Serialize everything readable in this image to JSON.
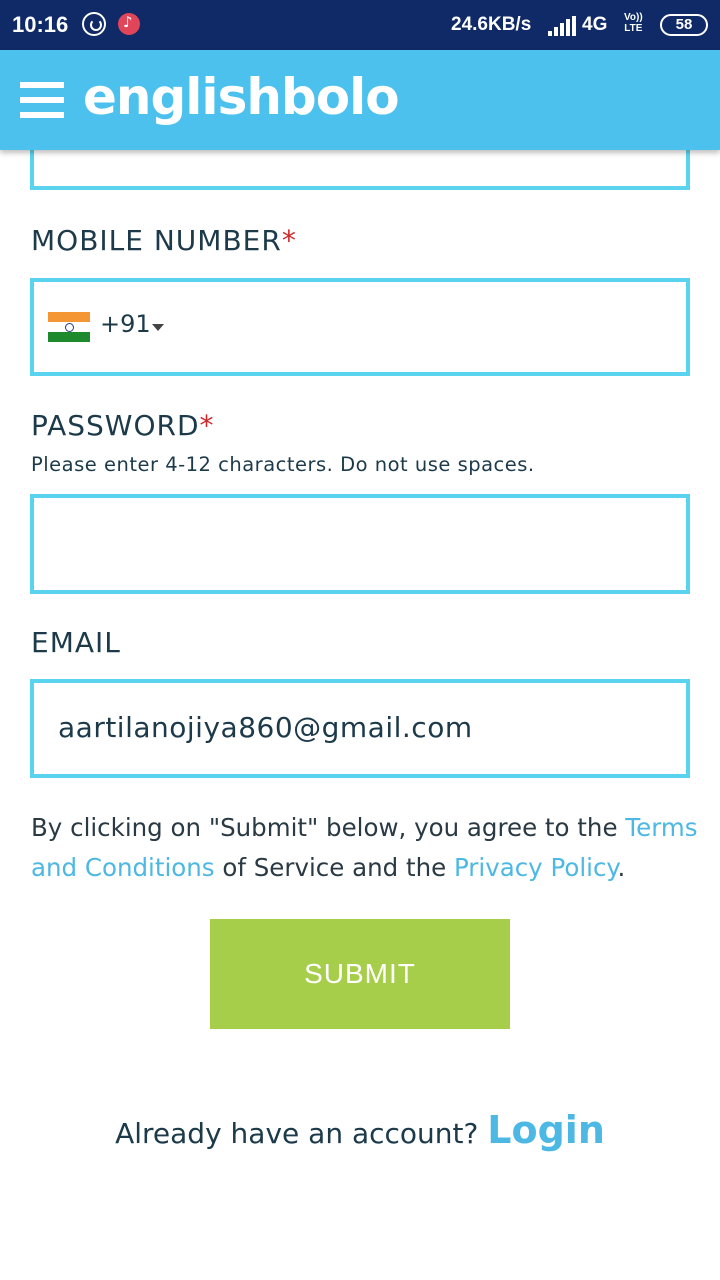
{
  "status_bar": {
    "time": "10:16",
    "net_speed": "24.6KB/s",
    "network": "4G",
    "volte_top": "Vo))",
    "volte_bottom": "LTE",
    "battery": "58",
    "icons": [
      "whatsapp-icon",
      "music-notification-icon",
      "signal-icon",
      "battery-icon"
    ]
  },
  "header": {
    "logo": "englishbolo",
    "menu_icon": "hamburger-menu-icon",
    "background": "#4cc1ee"
  },
  "form": {
    "mobile": {
      "label": "MOBILE NUMBER",
      "required_mark": "*",
      "country_code": "+91",
      "flag_icon": "india-flag-icon"
    },
    "password": {
      "label": "PASSWORD",
      "required_mark": "*",
      "hint": "Please enter 4-12 characters. Do not use spaces.",
      "value": ""
    },
    "email": {
      "label": "EMAIL",
      "value": "aartilanojiya860@gmail.com"
    },
    "terms": {
      "prefix": "By clicking on \"Submit\" below, you agree to the ",
      "terms_link": "Terms and Conditions",
      "middle": " of Service and the ",
      "privacy_link": "Privacy Policy",
      "suffix": "."
    },
    "submit_label": "SUBMIT",
    "submit_color": "#a6ce4a",
    "border_color": "#5ad3ee"
  },
  "footer": {
    "prompt": "Already have an account?",
    "login_link": "Login"
  }
}
